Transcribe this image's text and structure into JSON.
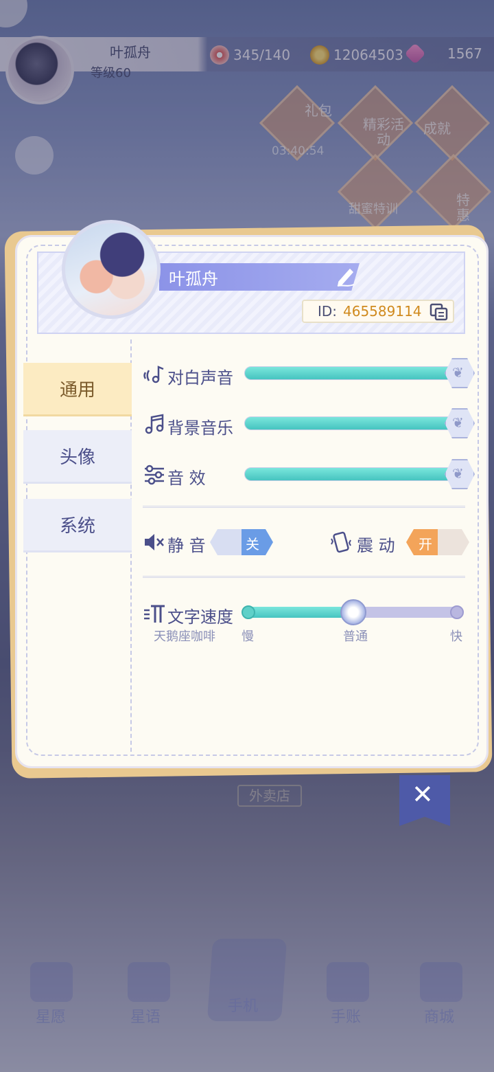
{
  "hud": {
    "player_name": "叶孤舟",
    "level": "等级60",
    "stamina": "345/140",
    "gold": "12064503",
    "gems": "1567",
    "timer": "03:40:54",
    "events": [
      "礼包",
      "精彩活动",
      "成就",
      "甜蜜特训",
      "特惠"
    ]
  },
  "background": {
    "shop_sign": "外卖店"
  },
  "bottom_nav": [
    "星愿",
    "星语",
    "手机",
    "手账",
    "商城"
  ],
  "profile": {
    "name": "叶孤舟",
    "id_label": "ID:",
    "id_value": "465589114"
  },
  "tabs": [
    {
      "label": "通用",
      "active": true
    },
    {
      "label": "头像",
      "active": false
    },
    {
      "label": "系统",
      "active": false
    }
  ],
  "sliders": [
    {
      "label": "对白声音",
      "icon": "voice-icon",
      "value": 1.0
    },
    {
      "label": "背景音乐",
      "icon": "music-note-icon",
      "value": 1.0
    },
    {
      "label": "音 效",
      "icon": "equalizer-icon",
      "value": 1.0
    }
  ],
  "toggles": {
    "mute": {
      "label": "静 音",
      "state": "关",
      "on": false
    },
    "vibrate": {
      "label": "震 动",
      "state": "开",
      "on": true
    }
  },
  "text_speed": {
    "label": "文字速度",
    "sample": "天鹅座咖啡",
    "ticks": [
      "慢",
      "普通",
      "快"
    ],
    "value": "普通"
  },
  "colors": {
    "accent": "#8c93e8",
    "slider_fill": "#46c4c0",
    "id_value": "#d08a1e",
    "toggle_on": "#f3a45a"
  }
}
